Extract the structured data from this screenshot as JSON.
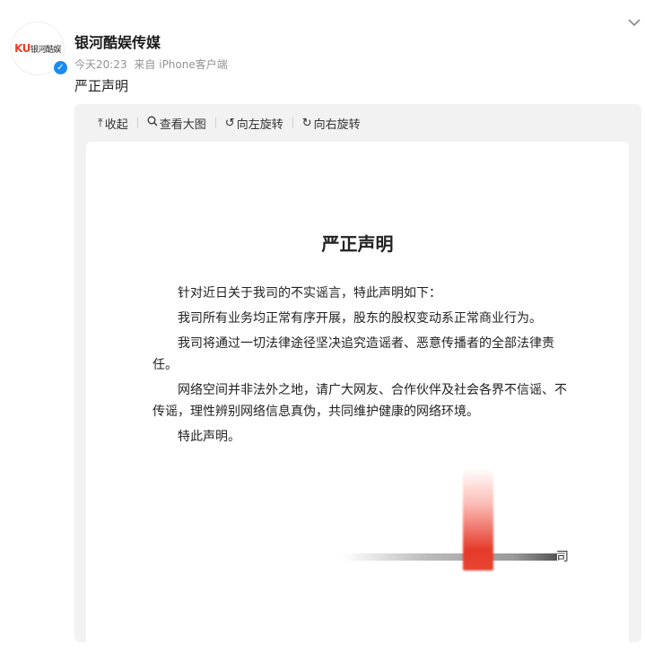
{
  "post": {
    "author": "银河酷娱传媒",
    "avatar_logo_ku": "KU",
    "avatar_logo_text": "银河酷娱",
    "time": "今天20:23",
    "source": "来自 iPhone客户端",
    "text": "严正声明"
  },
  "toolbar": {
    "collapse": "收起",
    "view_large": "查看大图",
    "rotate_left": "向左旋转",
    "rotate_right": "向右旋转"
  },
  "document": {
    "title": "严正声明",
    "paragraphs": [
      "针对近日关于我司的不实谣言，特此声明如下：",
      "我司所有业务均正常有序开展，股东的股权变动系正常商业行为。",
      "我司将通过一切法律途径坚决追究造谣者、恶意传播者的全部法律责任。",
      "网络空间并非法外之地，请广大网友、合作伙伴及社会各界不信谣、不传谣，理性辨别网络信息真伪，共同维护健康的网络环境。",
      "特此声明。"
    ],
    "signature_tail": "司"
  },
  "colors": {
    "brand_red": "#e8402d",
    "verified_blue": "#1b8bf2",
    "stamp_red": "#e63a2a"
  },
  "icons": [
    "chevron-down-icon",
    "verified-badge-icon",
    "collapse-icon",
    "magnifier-icon",
    "rotate-left-icon",
    "rotate-right-icon"
  ]
}
